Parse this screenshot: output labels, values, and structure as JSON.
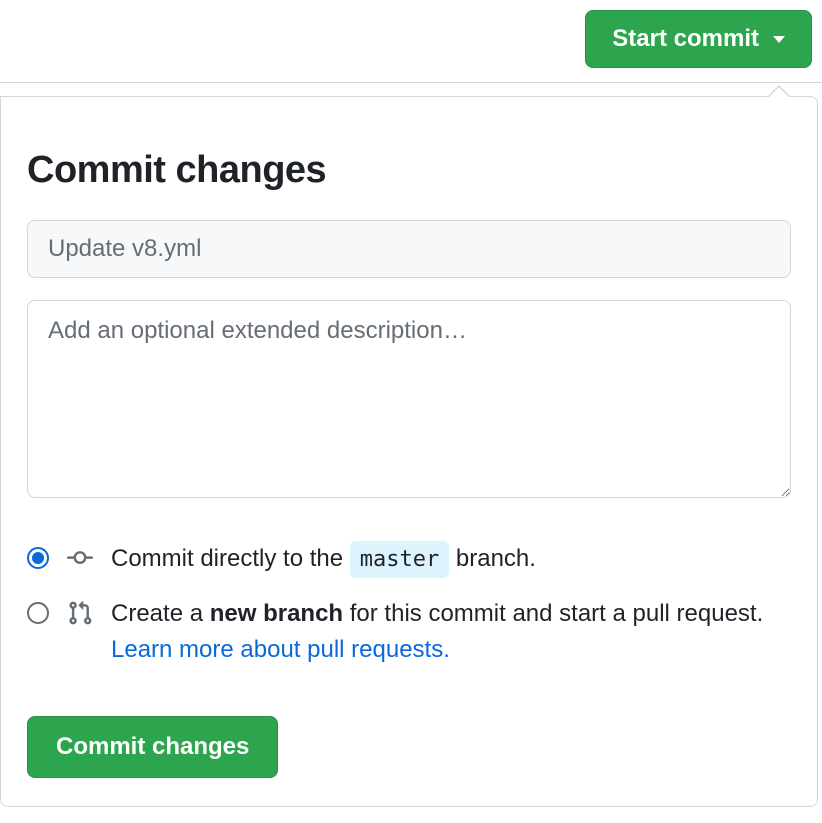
{
  "topbar": {
    "start_commit_label": "Start commit"
  },
  "popover": {
    "heading": "Commit changes",
    "summary_placeholder": "Update v8.yml",
    "summary_value": "",
    "description_placeholder": "Add an optional extended description…",
    "description_value": "",
    "options": {
      "direct": {
        "selected": true,
        "text_prefix": "Commit directly to the ",
        "branch_name": "master",
        "text_suffix": " branch."
      },
      "new_branch": {
        "selected": false,
        "text_prefix": "Create a ",
        "bold_text": "new branch",
        "text_middle": " for this commit and start a pull request. ",
        "link_text": "Learn more about pull requests."
      }
    },
    "commit_button_label": "Commit changes"
  }
}
